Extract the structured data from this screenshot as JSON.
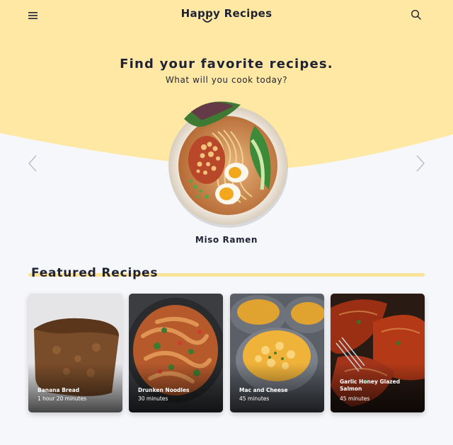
{
  "header": {
    "brand": "Happy Recipes",
    "menu_icon": "hamburger-menu-icon",
    "search_icon": "search-icon"
  },
  "hero": {
    "title": "Find your favorite recipes.",
    "subtitle": "What will you cook today?",
    "dish_name": "Miso Ramen",
    "prev_icon": "chevron-left-icon",
    "next_icon": "chevron-right-icon"
  },
  "featured": {
    "title": "Featured Recipes",
    "cards": [
      {
        "name": "Banana Bread",
        "time": "1 hour 20 minutes"
      },
      {
        "name": "Drunken Noodles",
        "time": "30 minutes"
      },
      {
        "name": "Mac and Cheese",
        "time": "45 minutes"
      },
      {
        "name": "Garlic Honey Glazed Salmon",
        "time": "45 minutes"
      }
    ]
  },
  "colors": {
    "hero_yellow": "#ffe8a3",
    "accent_line": "#fbe39a",
    "page_bg": "#f6f7fb",
    "text_dark": "#1f2233"
  }
}
